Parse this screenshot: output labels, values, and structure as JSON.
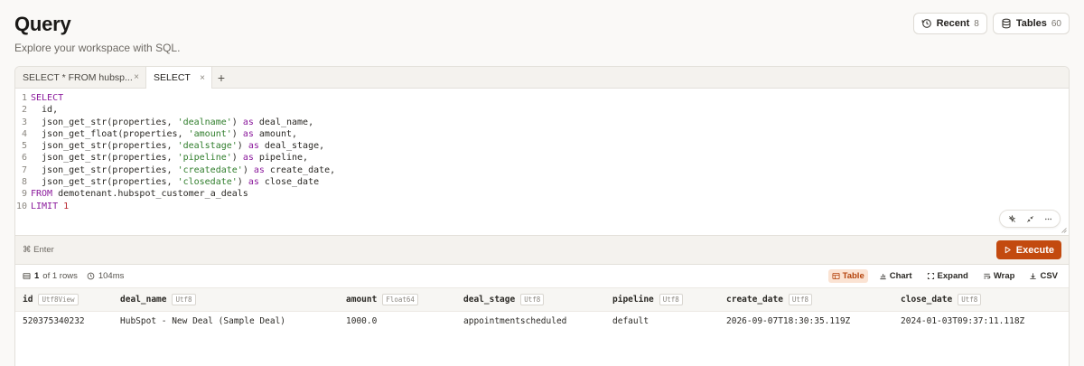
{
  "header": {
    "title": "Query",
    "subtitle": "Explore your workspace with SQL.",
    "recent": {
      "label": "Recent",
      "count": "8"
    },
    "tables": {
      "label": "Tables",
      "count": "60"
    }
  },
  "tabs": [
    {
      "label": "SELECT * FROM hubsp...",
      "close": "×"
    },
    {
      "label": "SELECT",
      "close": "×"
    }
  ],
  "add_tab": "+",
  "editor": {
    "line_numbers": [
      "1",
      "2",
      "3",
      "4",
      "5",
      "6",
      "7",
      "8",
      "9",
      "10"
    ],
    "lines": [
      [
        {
          "t": "SELECT",
          "c": "kw"
        }
      ],
      [
        {
          "t": "  id,",
          "c": ""
        }
      ],
      [
        {
          "t": "  json_get_str(properties, ",
          "c": ""
        },
        {
          "t": "'dealname'",
          "c": "str"
        },
        {
          "t": ") ",
          "c": ""
        },
        {
          "t": "as",
          "c": "kw"
        },
        {
          "t": " deal_name,",
          "c": ""
        }
      ],
      [
        {
          "t": "  json_get_float(properties, ",
          "c": ""
        },
        {
          "t": "'amount'",
          "c": "str"
        },
        {
          "t": ") ",
          "c": ""
        },
        {
          "t": "as",
          "c": "kw"
        },
        {
          "t": " amount,",
          "c": ""
        }
      ],
      [
        {
          "t": "  json_get_str(properties, ",
          "c": ""
        },
        {
          "t": "'dealstage'",
          "c": "str"
        },
        {
          "t": ") ",
          "c": ""
        },
        {
          "t": "as",
          "c": "kw"
        },
        {
          "t": " deal_stage,",
          "c": ""
        }
      ],
      [
        {
          "t": "  json_get_str(properties, ",
          "c": ""
        },
        {
          "t": "'pipeline'",
          "c": "str"
        },
        {
          "t": ") ",
          "c": ""
        },
        {
          "t": "as",
          "c": "kw"
        },
        {
          "t": " pipeline,",
          "c": ""
        }
      ],
      [
        {
          "t": "  json_get_str(properties, ",
          "c": ""
        },
        {
          "t": "'createdate'",
          "c": "str"
        },
        {
          "t": ") ",
          "c": ""
        },
        {
          "t": "as",
          "c": "kw"
        },
        {
          "t": " create_date,",
          "c": ""
        }
      ],
      [
        {
          "t": "  json_get_str(properties, ",
          "c": ""
        },
        {
          "t": "'closedate'",
          "c": "str"
        },
        {
          "t": ") ",
          "c": ""
        },
        {
          "t": "as",
          "c": "kw"
        },
        {
          "t": " close_date",
          "c": ""
        }
      ],
      [
        {
          "t": "FROM",
          "c": "kw"
        },
        {
          "t": " demotenant.hubspot_customer_a_deals",
          "c": ""
        }
      ],
      [
        {
          "t": "LIMIT",
          "c": "kw"
        },
        {
          "t": " ",
          "c": ""
        },
        {
          "t": "1",
          "c": "num"
        }
      ]
    ],
    "tools": [
      "sparkle-off-icon",
      "collapse-icon",
      "more-icon"
    ]
  },
  "exec": {
    "hint": "⌘ Enter",
    "button": "Execute"
  },
  "results": {
    "rows_count": "1",
    "rows_suffix": "of 1 rows",
    "time": "104ms",
    "views": {
      "table": "Table",
      "chart": "Chart",
      "expand": "Expand",
      "wrap": "Wrap",
      "csv": "CSV"
    }
  },
  "table": {
    "columns": [
      {
        "name": "id",
        "type": "Utf8View"
      },
      {
        "name": "deal_name",
        "type": "Utf8"
      },
      {
        "name": "amount",
        "type": "Float64"
      },
      {
        "name": "deal_stage",
        "type": "Utf8"
      },
      {
        "name": "pipeline",
        "type": "Utf8"
      },
      {
        "name": "create_date",
        "type": "Utf8"
      },
      {
        "name": "close_date",
        "type": "Utf8"
      }
    ],
    "rows": [
      [
        "520375340232",
        "HubSpot - New Deal (Sample Deal)",
        "1000.0",
        "appointmentscheduled",
        "default",
        "2026-09-07T18:30:35.119Z",
        "2024-01-03T09:37:11.118Z"
      ]
    ]
  },
  "colors": {
    "accent": "#c34a0f",
    "keyword": "#8b1a9c",
    "string": "#2f7d2b",
    "number": "#b8262f"
  }
}
